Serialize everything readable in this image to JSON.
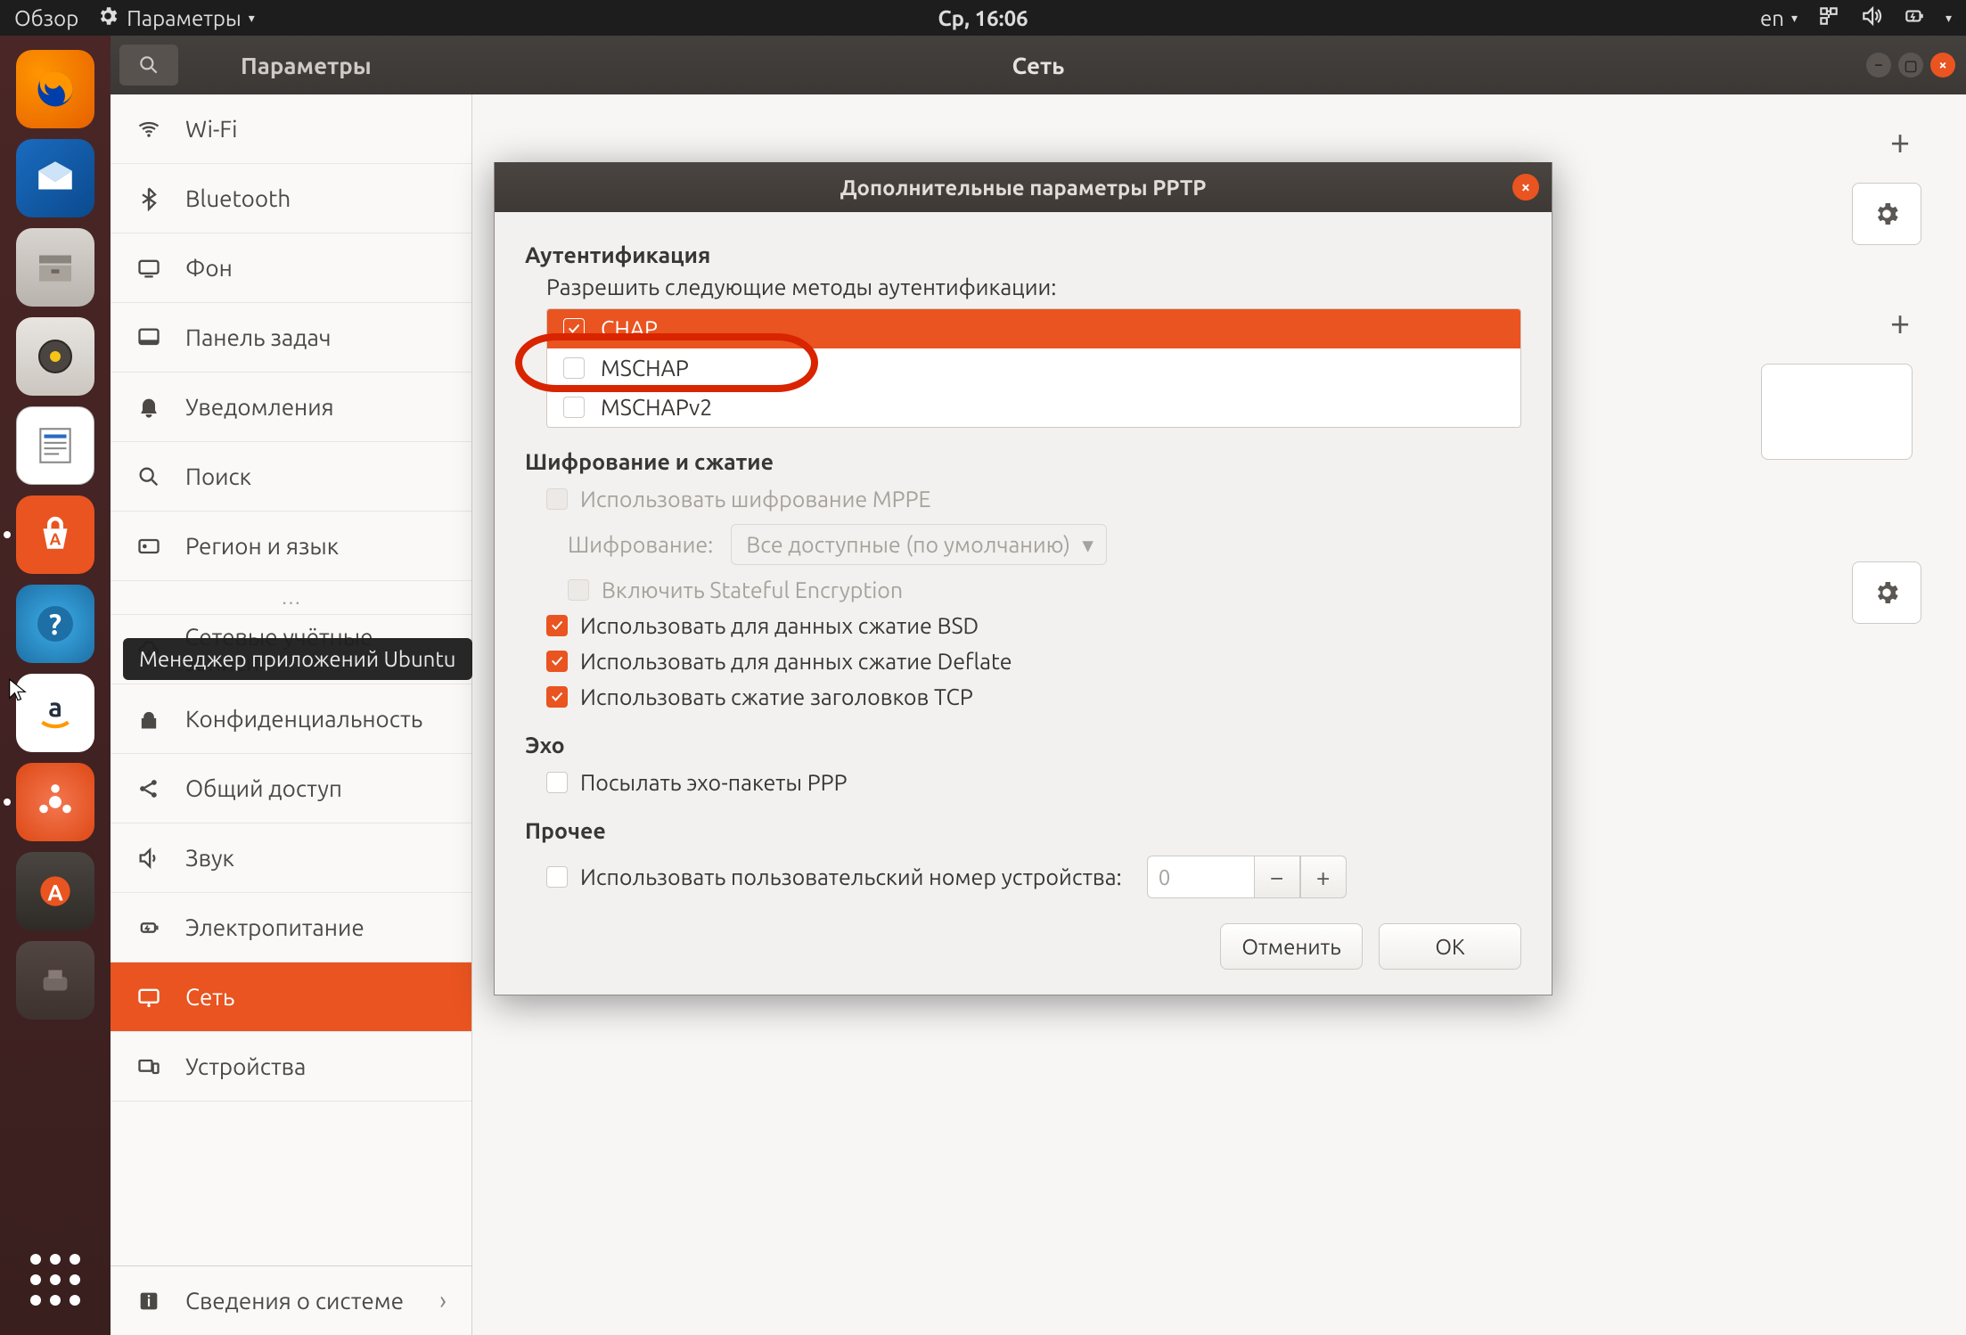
{
  "colors": {
    "accent": "#e95420",
    "highlight": "#d92400"
  },
  "top_panel": {
    "overview": "Обзор",
    "app_menu": "Параметры",
    "clock": "Ср, 16:06",
    "lang": "en"
  },
  "tooltip": "Менеджер приложений Ubuntu",
  "launcher": {
    "items": [
      {
        "name": "firefox"
      },
      {
        "name": "thunderbird"
      },
      {
        "name": "files"
      },
      {
        "name": "rhythmbox"
      },
      {
        "name": "writer"
      },
      {
        "name": "software",
        "active": true
      },
      {
        "name": "help"
      },
      {
        "name": "amazon"
      },
      {
        "name": "ubuntu-settings"
      },
      {
        "name": "software-updater"
      },
      {
        "name": "additional"
      }
    ]
  },
  "settings": {
    "header": {
      "sidebar_title": "Параметры",
      "main_title": "Сеть"
    },
    "sidebar": {
      "items": [
        {
          "id": "wifi",
          "label": "Wi-Fi"
        },
        {
          "id": "bluetooth",
          "label": "Bluetooth"
        },
        {
          "id": "background",
          "label": "Фон"
        },
        {
          "id": "dock",
          "label": "Панель задач"
        },
        {
          "id": "notifications",
          "label": "Уведомления"
        },
        {
          "id": "search",
          "label": "Поиск"
        },
        {
          "id": "region",
          "label": "Регион и язык"
        },
        {
          "id": "ellipsis",
          "label": "…"
        },
        {
          "id": "online-accounts",
          "label": "Сетевые учётные записи"
        },
        {
          "id": "privacy",
          "label": "Конфиденциальность"
        },
        {
          "id": "sharing",
          "label": "Общий доступ"
        },
        {
          "id": "sound",
          "label": "Звук"
        },
        {
          "id": "power",
          "label": "Электропитание"
        },
        {
          "id": "network",
          "label": "Сеть",
          "selected": true
        },
        {
          "id": "devices",
          "label": "Устройства"
        }
      ],
      "about": "Сведения о системе"
    }
  },
  "modal": {
    "title": "Дополнительные параметры PPTP",
    "auth": {
      "heading": "Аутентификация",
      "subtitle": "Разрешить следующие методы аутентификации:",
      "methods": [
        {
          "name": "CHAP",
          "checked": true,
          "selected": true
        },
        {
          "name": "MSCHAP",
          "checked": false,
          "selected": false
        },
        {
          "name": "MSCHAPv2",
          "checked": false,
          "selected": false
        }
      ]
    },
    "encryption": {
      "heading": "Шифрование и сжатие",
      "use_mppe": "Использовать шифрование MPPE",
      "enc_label": "Шифрование:",
      "enc_combo": "Все доступные (по умолчанию)",
      "stateful": "Включить Stateful Encryption",
      "bsd": "Использовать для данных сжатие BSD",
      "deflate": "Использовать для данных сжатие Deflate",
      "tcp": "Использовать сжатие заголовков TCP"
    },
    "echo": {
      "heading": "Эхо",
      "send_ppp": "Посылать эхо-пакеты PPP"
    },
    "misc": {
      "heading": "Прочее",
      "custom_unit": "Использовать пользовательский номер устройства:",
      "unit_value": "0"
    },
    "actions": {
      "cancel": "Отменить",
      "ok": "ОК"
    }
  }
}
